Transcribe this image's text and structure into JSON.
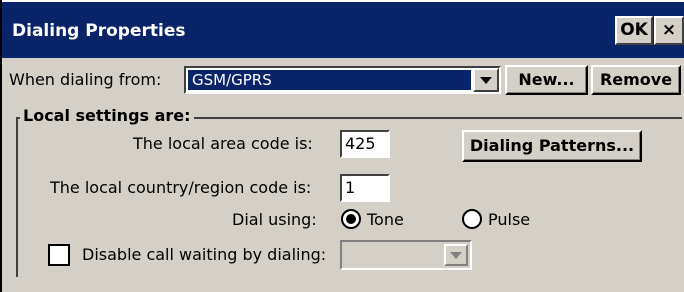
{
  "window": {
    "title": "Dialing Properties",
    "ok_label": "OK",
    "close_label": "×"
  },
  "dialing_from": {
    "label": "When dialing from:",
    "selected": "GSM/GPRS",
    "new_label": "New...",
    "remove_label": "Remove"
  },
  "local_settings": {
    "group_label": "Local settings are:",
    "area_code_label": "The local area code is:",
    "area_code_value": "425",
    "country_code_label": "The local country/region code is:",
    "country_code_value": "1",
    "dialing_patterns_label": "Dialing Patterns...",
    "dial_using_label": "Dial using:",
    "tone_label": "Tone",
    "pulse_label": "Pulse",
    "selected_dial_mode": "Tone",
    "disable_call_waiting_label": "Disable call waiting by dialing:",
    "disable_call_waiting_checked": false,
    "disable_call_waiting_value": ""
  }
}
